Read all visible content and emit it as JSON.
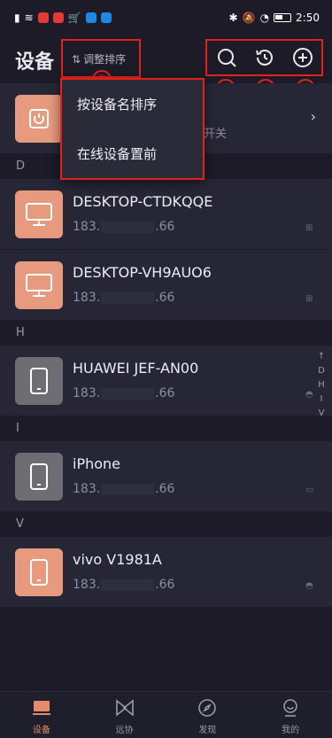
{
  "status_bar": {
    "time": "2:50"
  },
  "header": {
    "title": "设备",
    "sort_label": "调整排序",
    "icons": [
      "search-icon",
      "history-icon",
      "add-icon"
    ]
  },
  "annotations": [
    "①",
    "②",
    "③",
    "④"
  ],
  "dropdown": {
    "options": [
      "按设备名排序",
      "在线设备置前"
    ]
  },
  "top_row": {
    "switch_text": "开关"
  },
  "sections": [
    {
      "letter": "D",
      "devices": [
        {
          "name": "DESKTOP-CTDKQQE",
          "ip_prefix": "183.",
          "ip_suffix": ".66",
          "type": "desktop",
          "os": "windows"
        },
        {
          "name": "DESKTOP-VH9AUO6",
          "ip_prefix": "183.",
          "ip_suffix": ".66",
          "type": "desktop",
          "os": "windows"
        }
      ]
    },
    {
      "letter": "H",
      "devices": [
        {
          "name": "HUAWEI JEF-AN00",
          "ip_prefix": "183.",
          "ip_suffix": ".66",
          "type": "phone",
          "os": "android"
        }
      ]
    },
    {
      "letter": "I",
      "devices": [
        {
          "name": "iPhone",
          "ip_prefix": "183.",
          "ip_suffix": ".66",
          "type": "phone",
          "os": "ios"
        }
      ]
    },
    {
      "letter": "V",
      "devices": [
        {
          "name": "vivo V1981A",
          "ip_prefix": "183.",
          "ip_suffix": ".66",
          "type": "phone",
          "os": "android"
        }
      ]
    }
  ],
  "alpha_index": [
    "↑",
    "D",
    "H",
    "I",
    "V"
  ],
  "tabs": [
    {
      "label": "设备",
      "active": true
    },
    {
      "label": "远协",
      "active": false
    },
    {
      "label": "发现",
      "active": false
    },
    {
      "label": "我的",
      "active": false
    }
  ],
  "colors": {
    "accent": "#e58a6a",
    "annotation": "#e0211c",
    "background": "#1c1b27"
  }
}
